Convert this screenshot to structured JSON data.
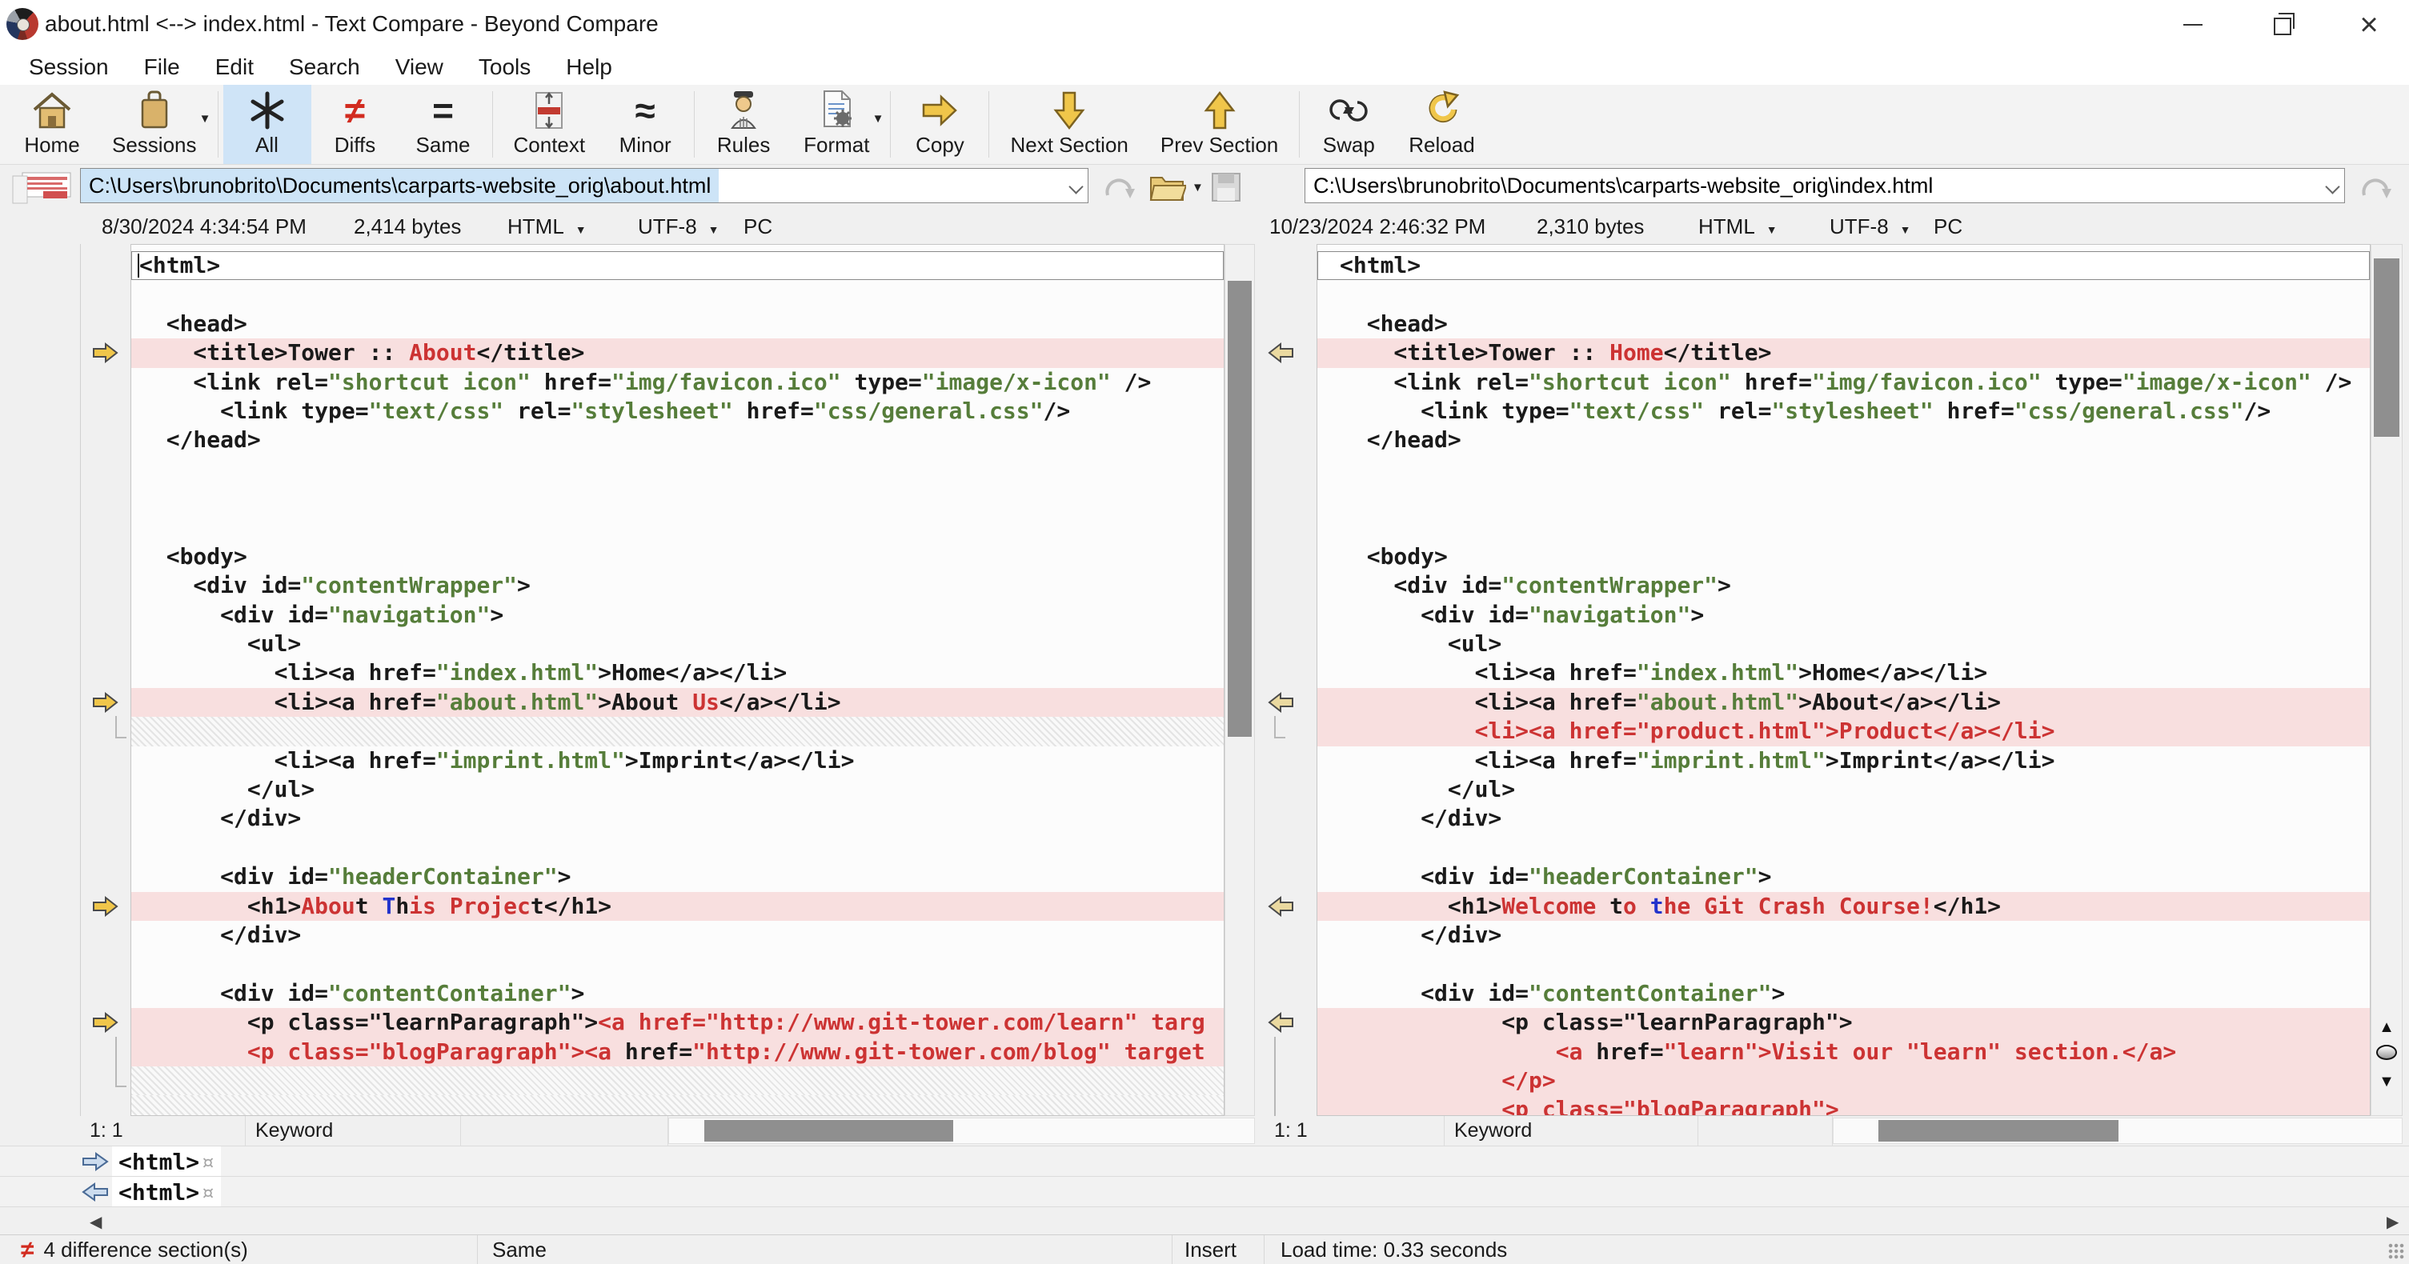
{
  "window": {
    "title": "about.html <--> index.html - Text Compare - Beyond Compare",
    "controls": [
      "minimize",
      "restore",
      "close"
    ]
  },
  "menu": {
    "items": [
      "Session",
      "File",
      "Edit",
      "Search",
      "View",
      "Tools",
      "Help"
    ]
  },
  "toolbar": {
    "items": [
      {
        "label": "Home",
        "icon": "home-icon"
      },
      {
        "label": "Sessions",
        "icon": "sessions-icon",
        "dropdown": true,
        "sep_after": true
      },
      {
        "label": "All",
        "icon": "all-icon",
        "active": true
      },
      {
        "label": "Diffs",
        "icon": "diffs-icon"
      },
      {
        "label": "Same",
        "icon": "same-icon",
        "sep_after": true
      },
      {
        "label": "Context",
        "icon": "context-icon"
      },
      {
        "label": "Minor",
        "icon": "minor-icon",
        "sep_after": true
      },
      {
        "label": "Rules",
        "icon": "rules-icon"
      },
      {
        "label": "Format",
        "icon": "format-icon",
        "dropdown": true,
        "sep_after": true
      },
      {
        "label": "Copy",
        "icon": "copy-icon",
        "sep_after": true
      },
      {
        "label": "Next Section",
        "icon": "next-section-icon"
      },
      {
        "label": "Prev Section",
        "icon": "prev-section-icon",
        "sep_after": true
      },
      {
        "label": "Swap",
        "icon": "swap-icon"
      },
      {
        "label": "Reload",
        "icon": "reload-icon"
      }
    ]
  },
  "left_file": {
    "path": "C:\\Users\\brunobrito\\Documents\\carparts-website_orig\\about.html",
    "modified": "8/30/2024 4:34:54 PM",
    "size": "2,414 bytes",
    "format": "HTML",
    "encoding": "UTF-8",
    "line_endings": "PC",
    "cursor_pos": "1: 1",
    "syntax_element": "Keyword"
  },
  "right_file": {
    "path": "C:\\Users\\brunobrito\\Documents\\carparts-website_orig\\index.html",
    "modified": "10/23/2024 2:46:32 PM",
    "size": "2,310 bytes",
    "format": "HTML",
    "encoding": "UTF-8",
    "line_endings": "PC",
    "cursor_pos": "1: 1",
    "syntax_element": "Keyword"
  },
  "detail": {
    "left_line": "<html>",
    "right_line": "<html>",
    "eol_mark": "¤"
  },
  "status_bar": {
    "differences": "4 difference section(s)",
    "compare_state": "Same",
    "edit_mode": "Insert",
    "load_time": "Load time: 0.33 seconds"
  },
  "theme": {
    "diff_row_bg": "#f8dfdf",
    "diff_text_red": "#cc3333",
    "unimportant_blue": "#2233cc",
    "string_green": "#567d3a",
    "active_button_bg": "#cfe4f7",
    "selection_bg": "#cde4f7",
    "arrow_gold": "#f0c64a",
    "arrow_pale_gold": "#ead9a0"
  },
  "left_lines": [
    {
      "s": [
        [
          "<html>",
          "k"
        ]
      ],
      "box": true,
      "caret": true
    },
    {
      "s": []
    },
    {
      "s": [
        [
          "  <head>",
          "k"
        ]
      ]
    },
    {
      "s": [
        [
          "    <title>Tower :: ",
          "k"
        ],
        [
          "About",
          "r"
        ],
        [
          "</title>",
          "k"
        ]
      ],
      "bg": "d",
      "a": "r"
    },
    {
      "s": [
        [
          "    <link rel=",
          "k"
        ],
        [
          "\"shortcut icon\"",
          "g"
        ],
        [
          " href=",
          "k"
        ],
        [
          "\"img/favicon.ico\"",
          "g"
        ],
        [
          " type=",
          "k"
        ],
        [
          "\"image/x-icon\"",
          "g"
        ],
        [
          " />",
          "k"
        ]
      ]
    },
    {
      "s": [
        [
          "      <link type=",
          "k"
        ],
        [
          "\"text/css\"",
          "g"
        ],
        [
          " rel=",
          "k"
        ],
        [
          "\"stylesheet\"",
          "g"
        ],
        [
          " href=",
          "k"
        ],
        [
          "\"css/general.css\"",
          "g"
        ],
        [
          "/>",
          "k"
        ]
      ]
    },
    {
      "s": [
        [
          "  </head>",
          "k"
        ]
      ]
    },
    {
      "s": []
    },
    {
      "s": []
    },
    {
      "s": []
    },
    {
      "s": [
        [
          "  <body>",
          "k"
        ]
      ]
    },
    {
      "s": [
        [
          "    <div id=",
          "k"
        ],
        [
          "\"contentWrapper\"",
          "g"
        ],
        [
          ">",
          "k"
        ]
      ]
    },
    {
      "s": [
        [
          "      <div id=",
          "k"
        ],
        [
          "\"navigation\"",
          "g"
        ],
        [
          ">",
          "k"
        ]
      ]
    },
    {
      "s": [
        [
          "        <ul>",
          "k"
        ]
      ]
    },
    {
      "s": [
        [
          "          <li><a href=",
          "k"
        ],
        [
          "\"index.html\"",
          "g"
        ],
        [
          ">Home</a></li>",
          "k"
        ]
      ]
    },
    {
      "s": [
        [
          "          <li><a href=",
          "k"
        ],
        [
          "\"about.html\"",
          "g"
        ],
        [
          ">About ",
          "k"
        ],
        [
          "Us",
          "r"
        ],
        [
          "</a></li>",
          "k"
        ]
      ],
      "bg": "d",
      "a": "r"
    },
    {
      "s": [],
      "bg": "h",
      "brk": "end"
    },
    {
      "s": [
        [
          "          <li><a href=",
          "k"
        ],
        [
          "\"imprint.html\"",
          "g"
        ],
        [
          ">Imprint</a></li>",
          "k"
        ]
      ]
    },
    {
      "s": [
        [
          "        </ul>",
          "k"
        ]
      ]
    },
    {
      "s": [
        [
          "      </div>",
          "k"
        ]
      ]
    },
    {
      "s": []
    },
    {
      "s": [
        [
          "      <div id=",
          "k"
        ],
        [
          "\"headerContainer\"",
          "g"
        ],
        [
          ">",
          "k"
        ]
      ]
    },
    {
      "s": [
        [
          "        <h1>",
          "k"
        ],
        [
          "Abou",
          "r"
        ],
        [
          "t ",
          "k"
        ],
        [
          "T",
          "b"
        ],
        [
          "h",
          "k"
        ],
        [
          "is Projec",
          "r"
        ],
        [
          "t",
          "k"
        ],
        [
          "</h1>",
          "k"
        ]
      ],
      "bg": "d",
      "a": "r"
    },
    {
      "s": [
        [
          "      </div>",
          "k"
        ]
      ]
    },
    {
      "s": []
    },
    {
      "s": [
        [
          "      <div id=",
          "k"
        ],
        [
          "\"contentContainer\"",
          "g"
        ],
        [
          ">",
          "k"
        ]
      ]
    },
    {
      "s": [
        [
          "        <p class=\"learnParagraph\">",
          "k"
        ],
        [
          "<a href=\"http://www.git-tower.com/learn\" targ",
          "r"
        ]
      ],
      "bg": "d",
      "a": "r"
    },
    {
      "s": [
        [
          "        ",
          "k"
        ],
        [
          "<p class=\"blogParagraph\"><a ",
          "r"
        ],
        [
          "href=",
          "k"
        ],
        [
          "\"http://www.git-tower.com/blog\" target",
          "r"
        ]
      ],
      "bg": "d",
      "brk": "mid"
    },
    {
      "s": [],
      "bg": "h",
      "brk": "end"
    },
    {
      "s": [],
      "bg": "h"
    }
  ],
  "right_lines": [
    {
      "s": [
        [
          "<html>",
          "k"
        ]
      ],
      "box": true
    },
    {
      "s": []
    },
    {
      "s": [
        [
          "  <head>",
          "k"
        ]
      ]
    },
    {
      "s": [
        [
          "    <title>Tower :: ",
          "k"
        ],
        [
          "Home",
          "r"
        ],
        [
          "</title>",
          "k"
        ]
      ],
      "bg": "d",
      "a": "l"
    },
    {
      "s": [
        [
          "    <link rel=",
          "k"
        ],
        [
          "\"shortcut icon\"",
          "g"
        ],
        [
          " href=",
          "k"
        ],
        [
          "\"img/favicon.ico\"",
          "g"
        ],
        [
          " type=",
          "k"
        ],
        [
          "\"image/x-icon\"",
          "g"
        ],
        [
          " />",
          "k"
        ]
      ]
    },
    {
      "s": [
        [
          "      <link type=",
          "k"
        ],
        [
          "\"text/css\"",
          "g"
        ],
        [
          " rel=",
          "k"
        ],
        [
          "\"stylesheet\"",
          "g"
        ],
        [
          " href=",
          "k"
        ],
        [
          "\"css/general.css\"",
          "g"
        ],
        [
          "/>",
          "k"
        ]
      ]
    },
    {
      "s": [
        [
          "  </head>",
          "k"
        ]
      ]
    },
    {
      "s": []
    },
    {
      "s": []
    },
    {
      "s": []
    },
    {
      "s": [
        [
          "  <body>",
          "k"
        ]
      ]
    },
    {
      "s": [
        [
          "    <div id=",
          "k"
        ],
        [
          "\"contentWrapper\"",
          "g"
        ],
        [
          ">",
          "k"
        ]
      ]
    },
    {
      "s": [
        [
          "      <div id=",
          "k"
        ],
        [
          "\"navigation\"",
          "g"
        ],
        [
          ">",
          "k"
        ]
      ]
    },
    {
      "s": [
        [
          "        <ul>",
          "k"
        ]
      ]
    },
    {
      "s": [
        [
          "          <li><a href=",
          "k"
        ],
        [
          "\"index.html\"",
          "g"
        ],
        [
          ">Home</a></li>",
          "k"
        ]
      ]
    },
    {
      "s": [
        [
          "          <li><a href=",
          "k"
        ],
        [
          "\"about.html\"",
          "g"
        ],
        [
          ">About</a></li>",
          "k"
        ]
      ],
      "bg": "d",
      "a": "l"
    },
    {
      "s": [
        [
          "          <li><a href=\"product.html\">Product</a></li>",
          "r"
        ]
      ],
      "bg": "d",
      "brk": "end"
    },
    {
      "s": [
        [
          "          <li><a href=",
          "k"
        ],
        [
          "\"imprint.html\"",
          "g"
        ],
        [
          ">Imprint</a></li>",
          "k"
        ]
      ]
    },
    {
      "s": [
        [
          "        </ul>",
          "k"
        ]
      ]
    },
    {
      "s": [
        [
          "      </div>",
          "k"
        ]
      ]
    },
    {
      "s": []
    },
    {
      "s": [
        [
          "      <div id=",
          "k"
        ],
        [
          "\"headerContainer\"",
          "g"
        ],
        [
          ">",
          "k"
        ]
      ]
    },
    {
      "s": [
        [
          "        <h1>",
          "k"
        ],
        [
          "Welcome ",
          "r"
        ],
        [
          "t",
          "k"
        ],
        [
          "o ",
          "r"
        ],
        [
          "t",
          "b"
        ],
        [
          "he Git Crash Course!",
          "r"
        ],
        [
          "</h1>",
          "k"
        ]
      ],
      "bg": "d",
      "a": "l"
    },
    {
      "s": [
        [
          "      </div>",
          "k"
        ]
      ]
    },
    {
      "s": []
    },
    {
      "s": [
        [
          "      <div id=",
          "k"
        ],
        [
          "\"contentContainer\"",
          "g"
        ],
        [
          ">",
          "k"
        ]
      ]
    },
    {
      "s": [
        [
          "            <p class=\"learnParagraph\">",
          "k"
        ]
      ],
      "bg": "d",
      "a": "l"
    },
    {
      "s": [
        [
          "                ",
          "k"
        ],
        [
          "<a ",
          "r"
        ],
        [
          "href=",
          "k"
        ],
        [
          "\"learn\">Visit our \"learn\" section.</a>",
          "r"
        ]
      ],
      "bg": "d",
      "brk": "mid"
    },
    {
      "s": [
        [
          "            </p>",
          "r"
        ]
      ],
      "bg": "d",
      "brk": "mid"
    },
    {
      "s": [
        [
          "            <p class=\"blogParagraph\">",
          "r"
        ]
      ],
      "bg": "d",
      "brk": "mid"
    }
  ]
}
